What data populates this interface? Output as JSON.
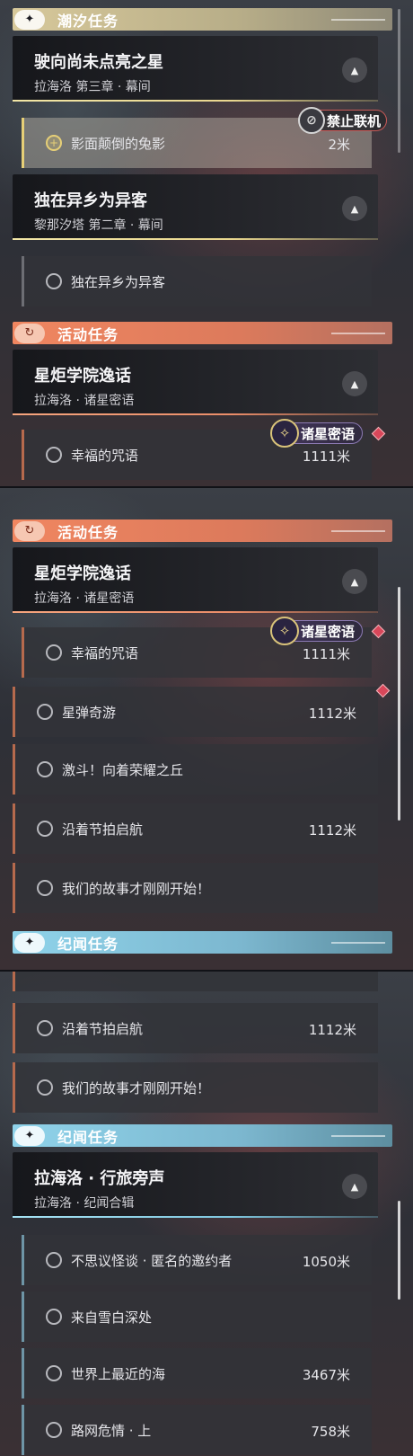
{
  "sections": {
    "tide": "潮汐任务",
    "event": "活动任务",
    "story": "纪闻任务"
  },
  "quests": {
    "star": {
      "title": "驶向尚未点亮之星",
      "sub": "拉海洛 第三章 · 幕间"
    },
    "alien": {
      "title": "独在异乡为异客",
      "sub": "黎那汐塔 第二章 · 幕间"
    },
    "academy": {
      "title": "星炬学院逸话",
      "sub": "拉海洛 · 诸星密语"
    },
    "travel": {
      "title": "拉海洛 · 行旅旁声",
      "sub": "拉海洛 · 纪闻合辑"
    }
  },
  "items": {
    "rabbit": {
      "name": "影面颠倒的兔影",
      "dist": "2米"
    },
    "alien_task": {
      "name": "独在异乡为异客"
    },
    "happy": {
      "name": "幸福的咒语",
      "dist": "1111米"
    },
    "bullet": {
      "name": "星弹奇游",
      "dist": "1112米"
    },
    "fight": {
      "name": "激斗！向着荣耀之丘"
    },
    "sail": {
      "name": "沿着节拍启航",
      "dist": "1112米"
    },
    "story_begin": {
      "name": "我们的故事才刚刚开始！"
    },
    "weird": {
      "name": "不思议怪谈 · 匿名的邀约者",
      "dist": "1050米"
    },
    "snow": {
      "name": "来自雪白深处"
    },
    "sea": {
      "name": "世界上最近的海",
      "dist": "3467米"
    },
    "road": {
      "name": "路网危情 · 上",
      "dist": "758米"
    }
  },
  "tags": {
    "ban": "禁止联机",
    "starwhisper": "诸星密语"
  },
  "colors": {
    "tide": "#d7c89a",
    "event": "#f08660",
    "story": "#8fd3ea",
    "gem": "#d8475a"
  },
  "icons": {
    "tide": "sparkle-icon",
    "event": "event-swirl-icon",
    "story": "sparkle-icon",
    "collapse": "chevron-up-icon",
    "radio": "empty-circle-icon",
    "track": "tracked-plus-icon"
  }
}
